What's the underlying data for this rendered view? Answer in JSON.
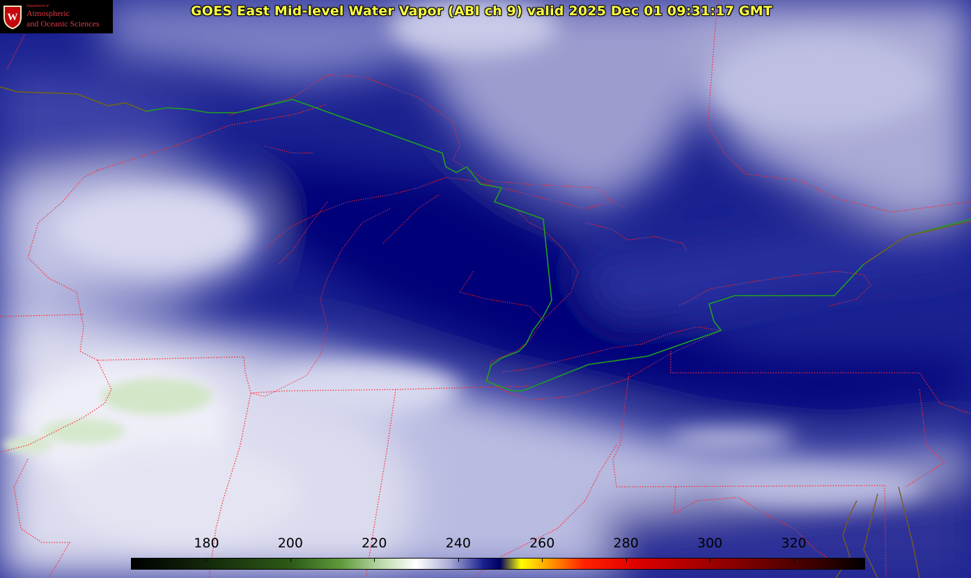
{
  "title": "GOES East Mid-level Water Vapor (ABI ch 9)  valid 2025 Dec 01 09:31:17 GMT",
  "logo": {
    "department": "Department of",
    "line1": "Atmospheric",
    "line2": "and Oceanic Sciences",
    "crest_letter": "W"
  },
  "colorbar": {
    "min": 162,
    "max": 337,
    "ticks": [
      180,
      200,
      220,
      240,
      260,
      280,
      300,
      320
    ],
    "stops": [
      {
        "v": 162,
        "c": "#000000"
      },
      {
        "v": 180,
        "c": "#13290a"
      },
      {
        "v": 200,
        "c": "#2d5a17"
      },
      {
        "v": 212,
        "c": "#5e9a3a"
      },
      {
        "v": 222,
        "c": "#bfdcae"
      },
      {
        "v": 230,
        "c": "#ffffff"
      },
      {
        "v": 238,
        "c": "#a9abd6"
      },
      {
        "v": 246,
        "c": "#1a1f8f"
      },
      {
        "v": 250,
        "c": "#000060"
      },
      {
        "v": 255,
        "c": "#ffff00"
      },
      {
        "v": 262,
        "c": "#ff9900"
      },
      {
        "v": 270,
        "c": "#ff2200"
      },
      {
        "v": 282,
        "c": "#e00000"
      },
      {
        "v": 305,
        "c": "#8c0000"
      },
      {
        "v": 325,
        "c": "#3c0000"
      },
      {
        "v": 337,
        "c": "#000000"
      }
    ]
  },
  "colors": {
    "state_borders": "#ff2a2a",
    "country_border": "#1fa01f",
    "coastline": "#7a5a20"
  }
}
